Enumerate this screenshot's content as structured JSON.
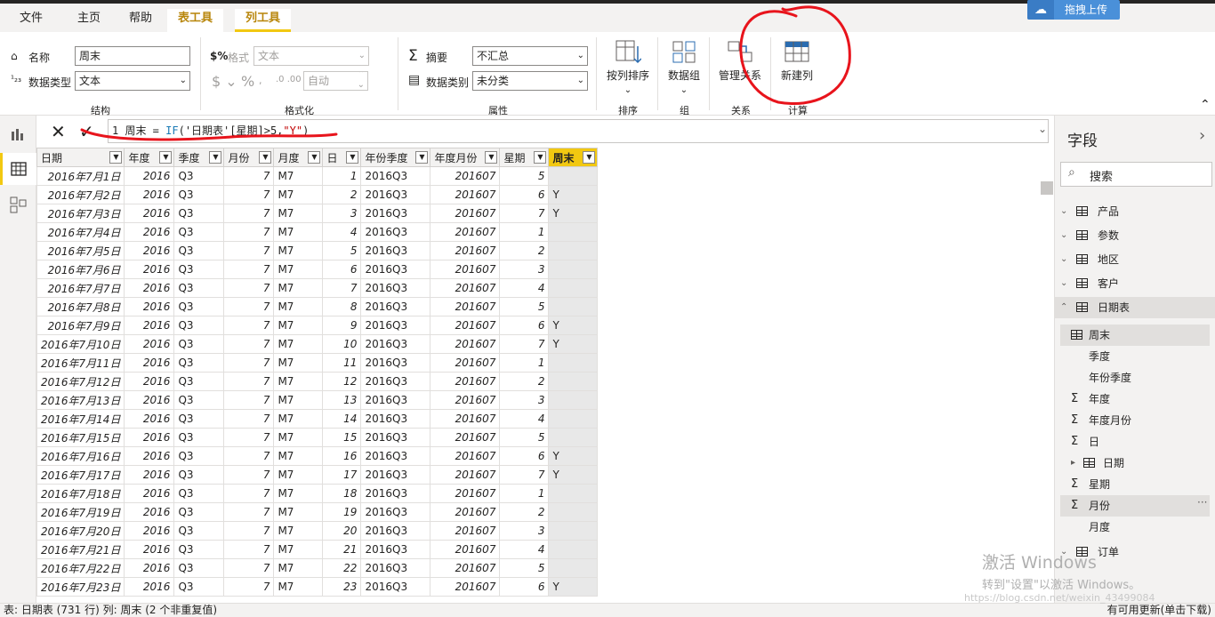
{
  "menu": {
    "tabs": [
      {
        "label": "文件"
      },
      {
        "label": "主页"
      },
      {
        "label": "帮助"
      },
      {
        "label": "表工具"
      },
      {
        "label": "列工具"
      }
    ],
    "upload_label": "拖拽上传"
  },
  "ribbon": {
    "name_label": "名称",
    "name_value": "周末",
    "dtype_label": "数据类型",
    "dtype_value": "文本",
    "format_label": "格式",
    "format_value": "文本",
    "auto_value": "自动",
    "group_structure": "结构",
    "group_format": "格式化",
    "summary_label": "摘要",
    "summary_value": "不汇总",
    "category_label": "数据类别",
    "category_value": "未分类",
    "group_properties": "属性",
    "sort_label": "按列排序",
    "group_sort": "排序",
    "datagroup_label": "数据组",
    "group_group": "组",
    "relations_label": "管理关系",
    "group_relations": "关系",
    "newcol_label": "新建列",
    "group_calc": "计算"
  },
  "formula": {
    "line": "1",
    "prefix": " 周末 = ",
    "fn": "IF",
    "open": "(",
    "table_ref": "'日期表'[星期]>5,",
    "str": "\"Y\"",
    "close": ")"
  },
  "table": {
    "columns": [
      "日期",
      "年度",
      "季度",
      "月份",
      "月度",
      "日",
      "年份季度",
      "年度月份",
      "星期",
      "周末"
    ],
    "rows": [
      [
        "2016年7月1日",
        "2016",
        "Q3",
        "7",
        "M7",
        "1",
        "2016Q3",
        "201607",
        "5",
        ""
      ],
      [
        "2016年7月2日",
        "2016",
        "Q3",
        "7",
        "M7",
        "2",
        "2016Q3",
        "201607",
        "6",
        "Y"
      ],
      [
        "2016年7月3日",
        "2016",
        "Q3",
        "7",
        "M7",
        "3",
        "2016Q3",
        "201607",
        "7",
        "Y"
      ],
      [
        "2016年7月4日",
        "2016",
        "Q3",
        "7",
        "M7",
        "4",
        "2016Q3",
        "201607",
        "1",
        ""
      ],
      [
        "2016年7月5日",
        "2016",
        "Q3",
        "7",
        "M7",
        "5",
        "2016Q3",
        "201607",
        "2",
        ""
      ],
      [
        "2016年7月6日",
        "2016",
        "Q3",
        "7",
        "M7",
        "6",
        "2016Q3",
        "201607",
        "3",
        ""
      ],
      [
        "2016年7月7日",
        "2016",
        "Q3",
        "7",
        "M7",
        "7",
        "2016Q3",
        "201607",
        "4",
        ""
      ],
      [
        "2016年7月8日",
        "2016",
        "Q3",
        "7",
        "M7",
        "8",
        "2016Q3",
        "201607",
        "5",
        ""
      ],
      [
        "2016年7月9日",
        "2016",
        "Q3",
        "7",
        "M7",
        "9",
        "2016Q3",
        "201607",
        "6",
        "Y"
      ],
      [
        "2016年7月10日",
        "2016",
        "Q3",
        "7",
        "M7",
        "10",
        "2016Q3",
        "201607",
        "7",
        "Y"
      ],
      [
        "2016年7月11日",
        "2016",
        "Q3",
        "7",
        "M7",
        "11",
        "2016Q3",
        "201607",
        "1",
        ""
      ],
      [
        "2016年7月12日",
        "2016",
        "Q3",
        "7",
        "M7",
        "12",
        "2016Q3",
        "201607",
        "2",
        ""
      ],
      [
        "2016年7月13日",
        "2016",
        "Q3",
        "7",
        "M7",
        "13",
        "2016Q3",
        "201607",
        "3",
        ""
      ],
      [
        "2016年7月14日",
        "2016",
        "Q3",
        "7",
        "M7",
        "14",
        "2016Q3",
        "201607",
        "4",
        ""
      ],
      [
        "2016年7月15日",
        "2016",
        "Q3",
        "7",
        "M7",
        "15",
        "2016Q3",
        "201607",
        "5",
        ""
      ],
      [
        "2016年7月16日",
        "2016",
        "Q3",
        "7",
        "M7",
        "16",
        "2016Q3",
        "201607",
        "6",
        "Y"
      ],
      [
        "2016年7月17日",
        "2016",
        "Q3",
        "7",
        "M7",
        "17",
        "2016Q3",
        "201607",
        "7",
        "Y"
      ],
      [
        "2016年7月18日",
        "2016",
        "Q3",
        "7",
        "M7",
        "18",
        "2016Q3",
        "201607",
        "1",
        ""
      ],
      [
        "2016年7月19日",
        "2016",
        "Q3",
        "7",
        "M7",
        "19",
        "2016Q3",
        "201607",
        "2",
        ""
      ],
      [
        "2016年7月20日",
        "2016",
        "Q3",
        "7",
        "M7",
        "20",
        "2016Q3",
        "201607",
        "3",
        ""
      ],
      [
        "2016年7月21日",
        "2016",
        "Q3",
        "7",
        "M7",
        "21",
        "2016Q3",
        "201607",
        "4",
        ""
      ],
      [
        "2016年7月22日",
        "2016",
        "Q3",
        "7",
        "M7",
        "22",
        "2016Q3",
        "201607",
        "5",
        ""
      ],
      [
        "2016年7月23日",
        "2016",
        "Q3",
        "7",
        "M7",
        "23",
        "2016Q3",
        "201607",
        "6",
        "Y"
      ]
    ]
  },
  "fields": {
    "title": "字段",
    "search_placeholder": "搜索",
    "tables": [
      "产品",
      "参数",
      "地区",
      "客户",
      "日期表"
    ],
    "date_fields": [
      {
        "label": "周末",
        "icon": "calc-column-icon"
      },
      {
        "label": "季度",
        "icon": ""
      },
      {
        "label": "年份季度",
        "icon": ""
      },
      {
        "label": "年度",
        "icon": "sigma-icon"
      },
      {
        "label": "年度月份",
        "icon": "sigma-icon"
      },
      {
        "label": "日",
        "icon": "sigma-icon"
      },
      {
        "label": "日期",
        "icon": "calendar-icon"
      },
      {
        "label": "星期",
        "icon": "sigma-icon"
      },
      {
        "label": "月份",
        "icon": "sigma-icon"
      },
      {
        "label": "月度",
        "icon": ""
      }
    ],
    "last_table": "订单",
    "more": "···"
  },
  "status": {
    "left": "表: 日期表 (731 行) 列: 周末 (2 个非重复值)",
    "right": "有可用更新(单击下载)"
  },
  "watermark": {
    "line1": "激活 Windows",
    "line2": "转到\"设置\"以激活 Windows。",
    "blog": "https://blog.csdn.net/weixin_43499084"
  },
  "colors": {
    "accent": "#f2c811",
    "annotation": "#e8141c",
    "context_tab": "#b8860b"
  }
}
